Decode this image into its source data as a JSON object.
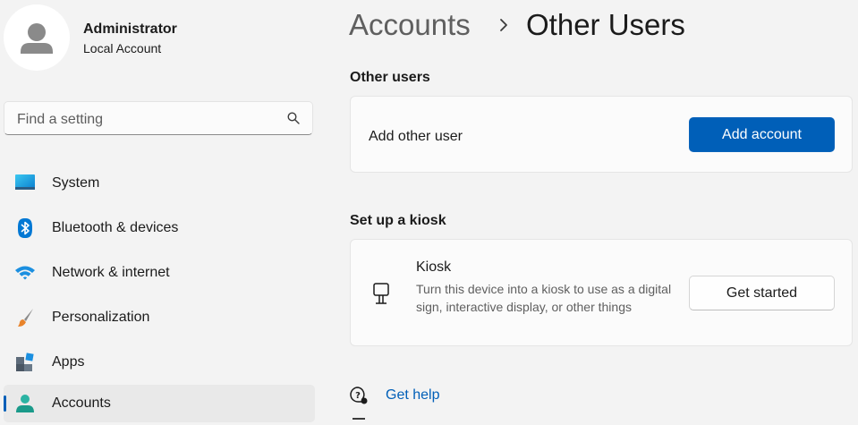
{
  "user": {
    "name": "Administrator",
    "account_type": "Local Account",
    "avatar_icon": "person-avatar-icon"
  },
  "search": {
    "placeholder": "Find a setting",
    "icon": "search-icon"
  },
  "sidebar": {
    "items": [
      {
        "label": "System",
        "icon": "system-display-icon",
        "active": false
      },
      {
        "label": "Bluetooth & devices",
        "icon": "bluetooth-icon",
        "active": false
      },
      {
        "label": "Network & internet",
        "icon": "wifi-icon",
        "active": false
      },
      {
        "label": "Personalization",
        "icon": "paintbrush-icon",
        "active": false
      },
      {
        "label": "Apps",
        "icon": "apps-icon",
        "active": false
      },
      {
        "label": "Accounts",
        "icon": "accounts-icon",
        "active": true
      }
    ]
  },
  "breadcrumb": {
    "parent": "Accounts",
    "current": "Other Users"
  },
  "other_users": {
    "section_title": "Other users",
    "row_label": "Add other user",
    "button_label": "Add account"
  },
  "kiosk": {
    "section_title": "Set up a kiosk",
    "title": "Kiosk",
    "description": "Turn this device into a kiosk to use as a digital sign, interactive display, or other things",
    "button_label": "Get started",
    "icon": "kiosk-sign-icon"
  },
  "help": {
    "label": "Get help",
    "icon": "help-chat-icon"
  },
  "colors": {
    "accent": "#005fb8",
    "background": "#f3f3f3",
    "card": "#fbfbfb"
  }
}
